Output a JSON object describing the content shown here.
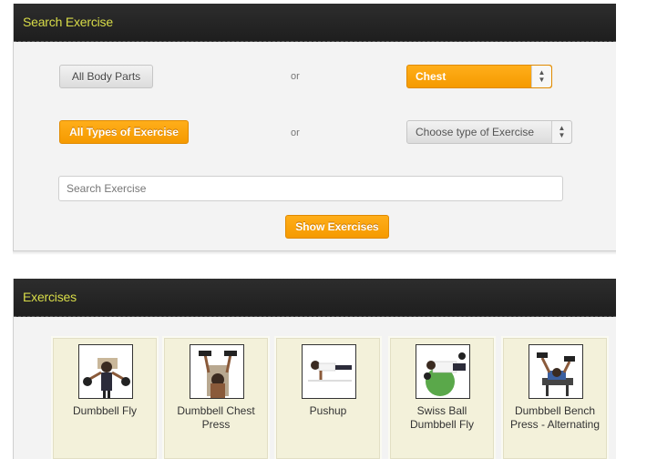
{
  "search_panel": {
    "title": "Search Exercise",
    "body_parts_button": "All Body Parts",
    "or_1": "or",
    "body_part_select": "Chest",
    "types_button": "All Types of Exercise",
    "or_2": "or",
    "type_select": "Choose type of Exercise",
    "search_placeholder": "Search Exercise",
    "show_button": "Show Exercises"
  },
  "exercises_panel": {
    "title": "Exercises",
    "items": [
      {
        "label": "Dumbbell Fly",
        "icon": "dumbbell-fly-image"
      },
      {
        "label": "Dumbbell Chest Press",
        "icon": "dumbbell-chest-press-image"
      },
      {
        "label": "Pushup",
        "icon": "pushup-image"
      },
      {
        "label": "Swiss Ball Dumbbell Fly",
        "icon": "swiss-ball-fly-image"
      },
      {
        "label": "Dumbbell Bench Press - Alternating",
        "icon": "bench-press-alternating-image"
      }
    ]
  },
  "colors": {
    "header_bg": "#1e1e1e",
    "header_text": "#d8dc48",
    "accent_orange": "#f59a00",
    "card_bg": "#f3f1da"
  }
}
